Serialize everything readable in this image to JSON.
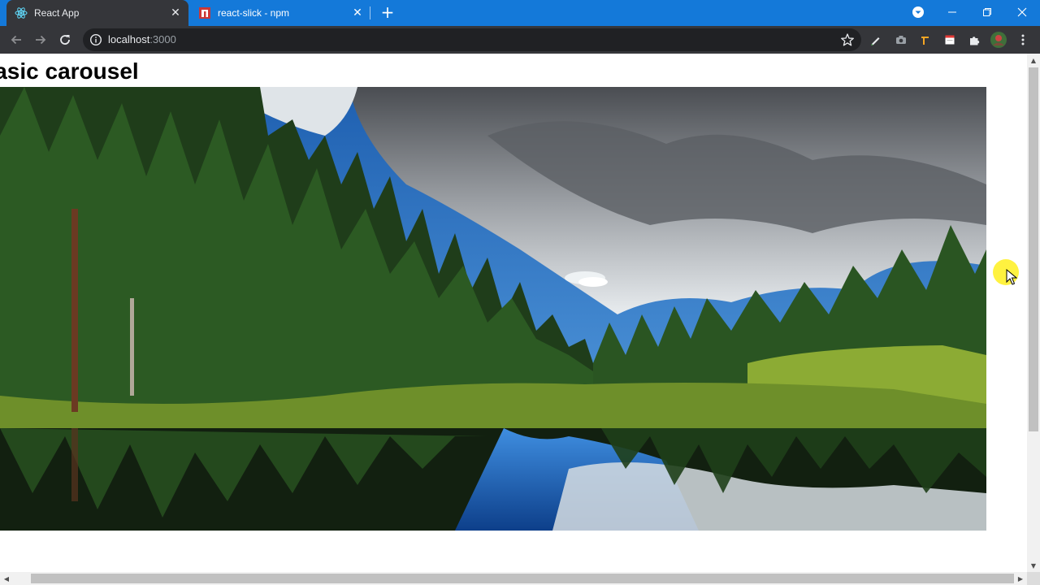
{
  "browser": {
    "tabs": [
      {
        "title": "React App",
        "active": true,
        "icon": "react-logo-icon"
      },
      {
        "title": "react-slick - npm",
        "active": false,
        "icon": "npm-logo-icon"
      }
    ],
    "url_host": "localhost",
    "url_port": ":3000"
  },
  "page": {
    "heading": "Basic carousel",
    "slide_image": "forest lake with clouds"
  },
  "colors": {
    "tabstrip": "#1479d9",
    "toolbar": "#35363a",
    "omnibox": "#202124"
  }
}
